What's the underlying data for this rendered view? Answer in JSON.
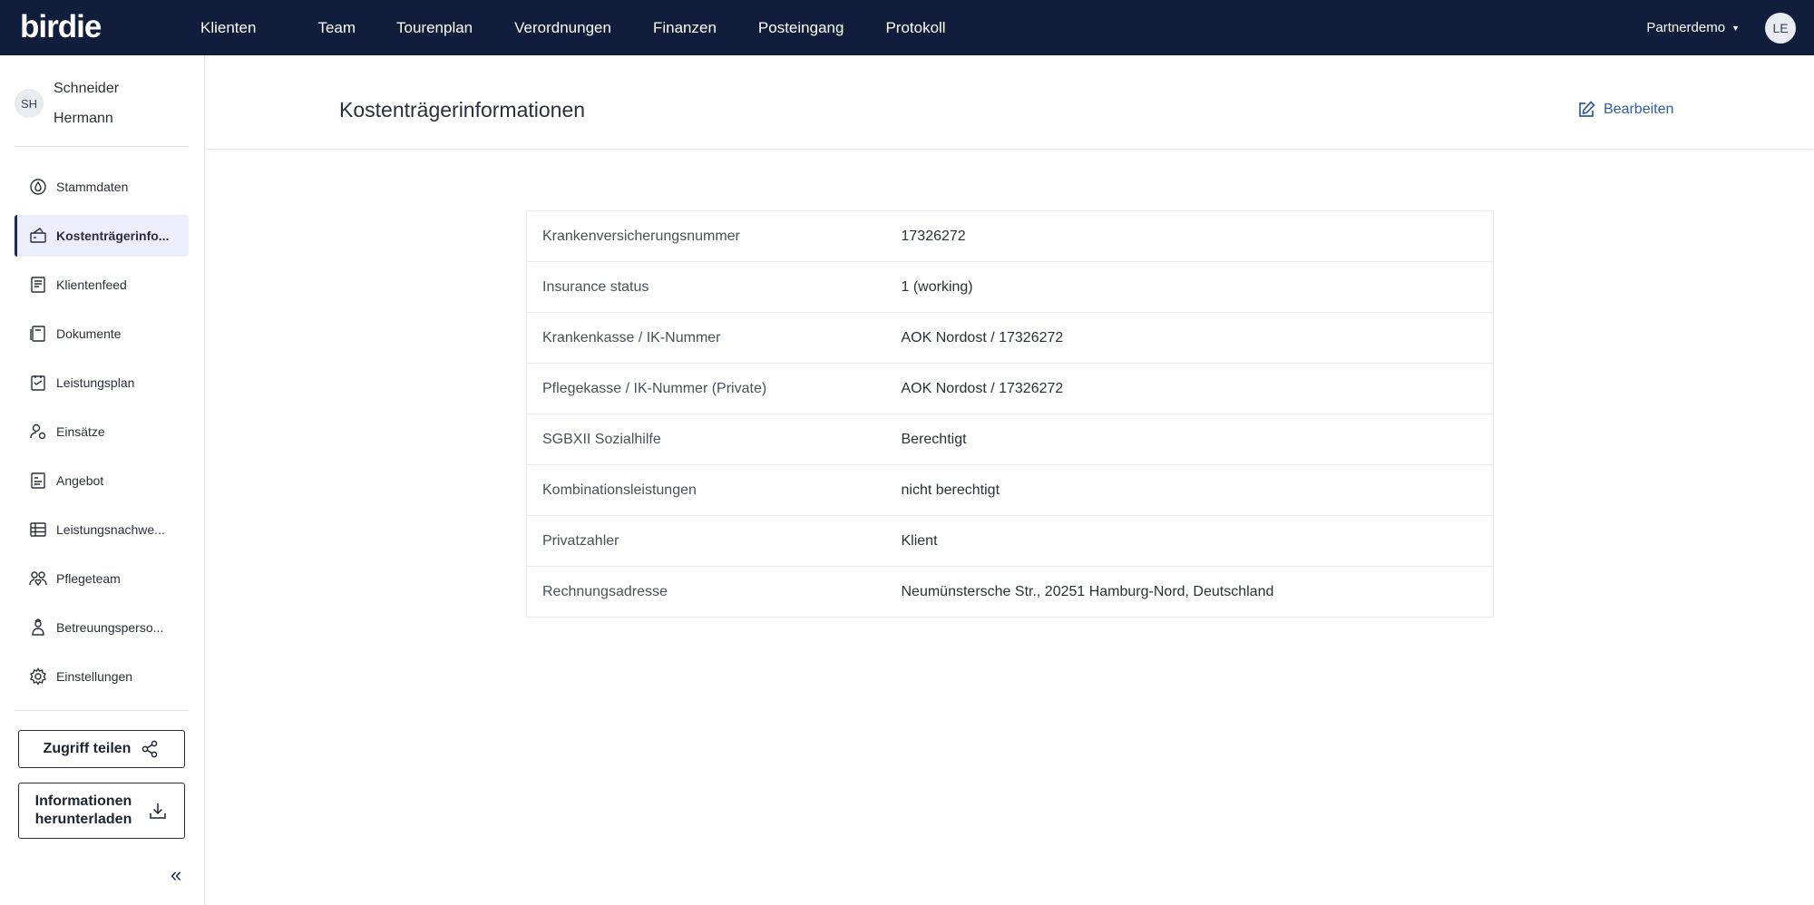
{
  "topbar": {
    "logo": "birdie",
    "nav": [
      "Klienten",
      "Team",
      "Tourenplan",
      "Verordnungen",
      "Finanzen",
      "Posteingang",
      "Protokoll"
    ],
    "partner_label": "Partnerdemo",
    "user_initials": "LE"
  },
  "sidebar": {
    "client_initials": "SH",
    "client_name_line1": "Schneider",
    "client_name_line2": "Hermann",
    "items": [
      {
        "label": "Stammdaten",
        "icon": "drop-icon"
      },
      {
        "label": "Kostenträgerinfo...",
        "icon": "card-icon"
      },
      {
        "label": "Klientenfeed",
        "icon": "feed-icon"
      },
      {
        "label": "Dokumente",
        "icon": "document-icon"
      },
      {
        "label": "Leistungsplan",
        "icon": "plan-icon"
      },
      {
        "label": "Einsätze",
        "icon": "visits-icon"
      },
      {
        "label": "Angebot",
        "icon": "offer-icon"
      },
      {
        "label": "Leistungsnachwe...",
        "icon": "table-icon"
      },
      {
        "label": "Pflegeteam",
        "icon": "team-icon"
      },
      {
        "label": "Betreuungsperso...",
        "icon": "caregiver-icon"
      },
      {
        "label": "Einstellungen",
        "icon": "gear-icon"
      }
    ],
    "share_button": "Zugriff teilen",
    "download_line1": "Informationen",
    "download_line2": "herunterladen",
    "collapse_glyph": "«"
  },
  "main": {
    "title": "Kostenträgerinformationen",
    "edit_label": "Bearbeiten",
    "rows": [
      {
        "key": "Krankenversicherungsnummer",
        "value": "17326272"
      },
      {
        "key": "Insurance status",
        "value": "1 (working)"
      },
      {
        "key": "Krankenkasse / IK-Nummer",
        "value": "AOK Nordost / 17326272"
      },
      {
        "key": "Pflegekasse / IK-Nummer (Private)",
        "value": "AOK Nordost / 17326272"
      },
      {
        "key": "SGBXII Sozialhilfe",
        "value": "Berechtigt"
      },
      {
        "key": "Kombinationsleistungen",
        "value": "nicht berechtigt"
      },
      {
        "key": "Privatzahler",
        "value": "Klient"
      },
      {
        "key": "Rechnungsadresse",
        "value": "Neumünstersche Str., 20251 Hamburg-Nord, Deutschland"
      }
    ]
  },
  "colors": {
    "nav_bg": "#101d3b",
    "accent": "#2f5aa8",
    "active_bg": "#eceefb"
  }
}
